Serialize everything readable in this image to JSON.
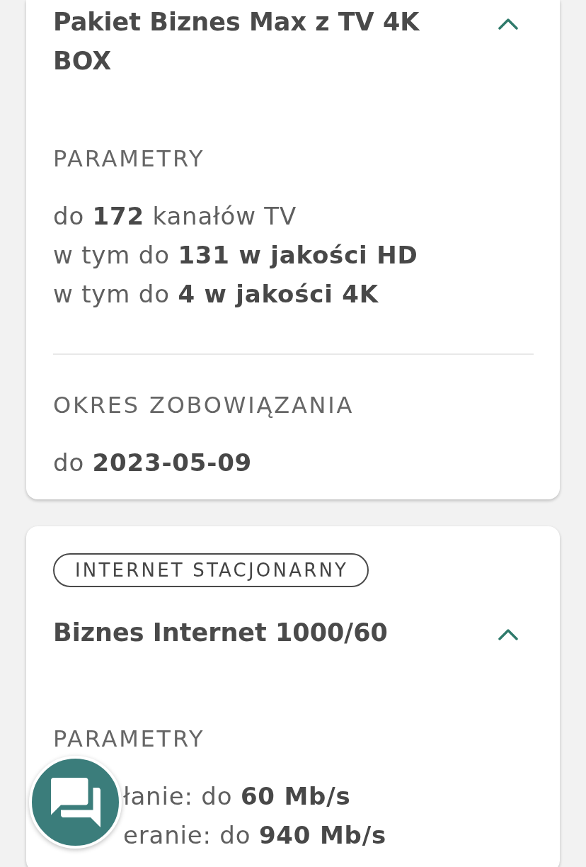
{
  "cards": [
    {
      "title": "Pakiet Biznes Max z TV 4K BOX",
      "expanded": true,
      "sections": [
        {
          "heading": "PARAMETRY",
          "lines": [
            "do **172** kanałów TV",
            "w tym do **131 w jakości HD**",
            "w tym do **4 w jakości 4K**"
          ]
        },
        {
          "heading": "OKRES ZOBOWIĄZANIA",
          "lines": [
            "do **2023-05-09**"
          ]
        }
      ]
    },
    {
      "badge": "INTERNET STACJONARNY",
      "title": "Biznes Internet 1000/60",
      "expanded": true,
      "sections": [
        {
          "heading": "PARAMETRY",
          "lines": [
            "łanie: do **60 Mb/s**",
            "eranie: do **940 Mb/s**"
          ]
        }
      ]
    }
  ]
}
